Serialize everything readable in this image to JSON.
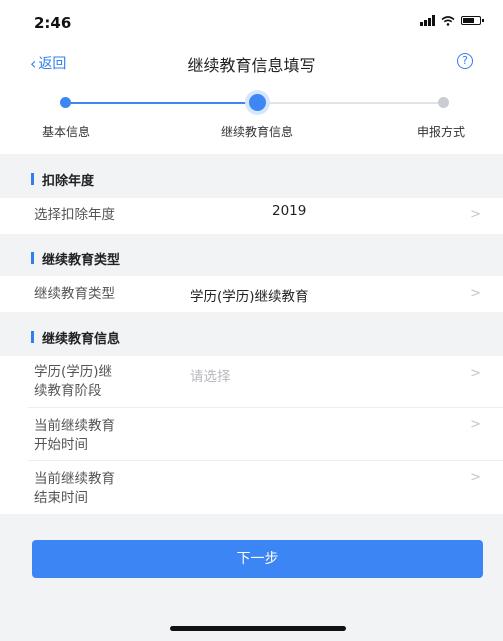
{
  "status": {
    "time": "2:46"
  },
  "nav": {
    "back_label": "返回",
    "title": "继续教育信息填写",
    "help_glyph": "?"
  },
  "steps": [
    {
      "label": "基本信息",
      "state": "done"
    },
    {
      "label": "继续教育信息",
      "state": "active"
    },
    {
      "label": "申报方式",
      "state": "todo"
    }
  ],
  "sections": {
    "deduction": {
      "title": "扣除年度",
      "row": {
        "label": "选择扣除年度",
        "value": "2019"
      }
    },
    "type": {
      "title": "继续教育类型",
      "row": {
        "label": "继续教育类型",
        "value": "学历(学历)继续教育"
      }
    },
    "info": {
      "title": "继续教育信息",
      "stage": {
        "label_line1": "学历(学历)继",
        "label_line2": "续教育阶段",
        "placeholder": "请选择"
      },
      "start": {
        "label_line1": "当前继续教育",
        "label_line2": "开始时间"
      },
      "end": {
        "label_line1": "当前继续教育",
        "label_line2": "结束时间"
      }
    }
  },
  "arrow_glyph": ">",
  "next_button": {
    "label": "下一步"
  },
  "colors": {
    "accent": "#3b86f4",
    "background": "#f2f3f5"
  }
}
